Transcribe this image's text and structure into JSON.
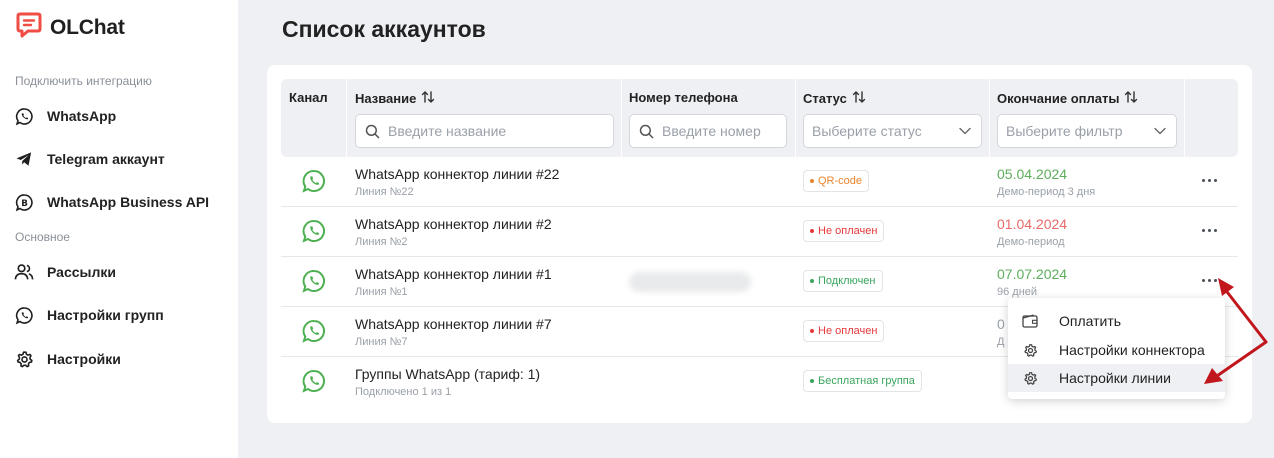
{
  "app": {
    "name": "OLChat",
    "brand_color": "#f04d44"
  },
  "sidebar": {
    "section_integrations": "Подключить интеграцию",
    "section_main": "Основное",
    "integrations": [
      {
        "label": "WhatsApp",
        "icon": "whatsapp-icon"
      },
      {
        "label": "Telegram аккаунт",
        "icon": "telegram-icon"
      },
      {
        "label": "WhatsApp Business API",
        "icon": "whatsapp-business-icon"
      }
    ],
    "main_items": [
      {
        "label": "Рассылки",
        "icon": "users-icon"
      },
      {
        "label": "Настройки групп",
        "icon": "whatsapp-icon"
      },
      {
        "label": "Настройки",
        "icon": "gear-icon"
      }
    ]
  },
  "page": {
    "title": "Список аккаунтов"
  },
  "table": {
    "columns": {
      "channel": "Канал",
      "name": "Название",
      "phone": "Номер телефона",
      "status": "Статус",
      "payment_end": "Окончание оплаты"
    },
    "filters": {
      "name_placeholder": "Введите название",
      "phone_placeholder": "Введите номер",
      "status_placeholder": "Выберите статус",
      "payment_placeholder": "Выберите фильтр"
    },
    "rows": [
      {
        "title": "WhatsApp коннектор линии #22",
        "subtitle": "Линия №22",
        "status": "QR-code",
        "status_color": "#e8852b",
        "date": "05.04.2024",
        "date_color": "#5cae5c",
        "date_note": "Демо-период 3 дня"
      },
      {
        "title": "WhatsApp коннектор линии #2",
        "subtitle": "Линия №2",
        "status": "Не оплачен",
        "status_color": "#e5393b",
        "date": "01.04.2024",
        "date_color": "#ea6a6a",
        "date_note": "Демо-период"
      },
      {
        "title": "WhatsApp коннектор линии #1",
        "subtitle": "Линия №1",
        "status": "Подключен",
        "status_color": "#3aa55d",
        "date": "07.07.2024",
        "date_color": "#5cae5c",
        "date_note": "96 дней"
      },
      {
        "title": "WhatsApp коннектор линии #7",
        "subtitle": "Линия №7",
        "status": "Не оплачен",
        "status_color": "#e5393b",
        "date": "0",
        "date_color": "#9aa0a8",
        "date_note": "Д"
      },
      {
        "title": "Группы WhatsApp (тариф: 1)",
        "subtitle": "Подключено 1 из 1",
        "status": "Бесплатная группа",
        "status_color": "#3aa55d",
        "date": "",
        "date_color": "#5cae5c",
        "date_note": ""
      }
    ]
  },
  "menu": {
    "items": [
      {
        "label": "Оплатить",
        "icon": "wallet-icon"
      },
      {
        "label": "Настройки коннектора",
        "icon": "gear-icon"
      },
      {
        "label": "Настройки линии",
        "icon": "gear-icon"
      }
    ]
  },
  "colors": {
    "whatsapp": "#4caf50",
    "annotation": "#c0161c"
  }
}
